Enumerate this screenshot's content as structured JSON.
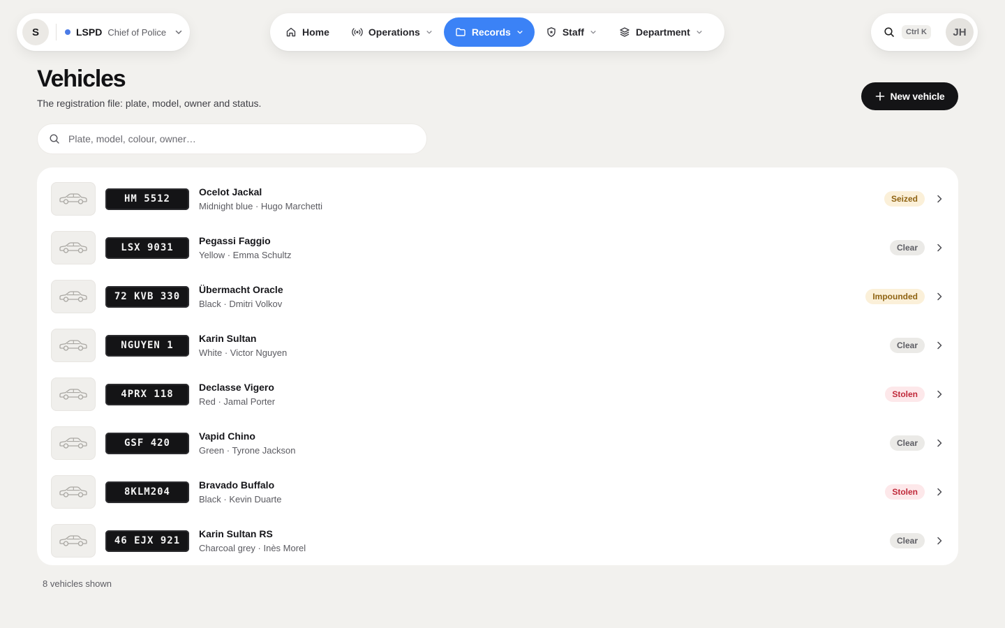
{
  "org": {
    "avatar_letter": "S",
    "name": "LSPD",
    "role": "Chief of Police",
    "status_color": "#4b7be6"
  },
  "nav": {
    "items": [
      {
        "label": "Home",
        "icon": "home-icon"
      },
      {
        "label": "Operations",
        "icon": "broadcast-icon"
      },
      {
        "label": "Records",
        "icon": "folder-icon"
      },
      {
        "label": "Staff",
        "icon": "shield-icon"
      },
      {
        "label": "Department",
        "icon": "layers-icon"
      }
    ],
    "active_color": "#3b82f6"
  },
  "util": {
    "shortcut": "Ctrl K",
    "user_initials": "JH"
  },
  "header": {
    "title": "Vehicles",
    "subtitle": "The registration file: plate, model, owner and status.",
    "new_button_label": "New vehicle"
  },
  "search": {
    "placeholder": "Plate, model, colour, owner…",
    "value": ""
  },
  "vehicles": [
    {
      "plate": "HM 5512",
      "model": "Ocelot Jackal",
      "meta": "Midnight blue · Hugo Marchetti",
      "status": "Seized"
    },
    {
      "plate": "LSX 9031",
      "model": "Pegassi Faggio",
      "meta": "Yellow · Emma Schultz",
      "status": "Clear"
    },
    {
      "plate": "72 KVB 330",
      "model": "Übermacht Oracle",
      "meta": "Black · Dmitri Volkov",
      "status": "Impounded"
    },
    {
      "plate": "NGUYEN 1",
      "model": "Karin Sultan",
      "meta": "White · Victor Nguyen",
      "status": "Clear"
    },
    {
      "plate": "4PRX 118",
      "model": "Declasse Vigero",
      "meta": "Red · Jamal Porter",
      "status": "Stolen"
    },
    {
      "plate": "GSF 420",
      "model": "Vapid Chino",
      "meta": "Green · Tyrone Jackson",
      "status": "Clear"
    },
    {
      "plate": "8KLM204",
      "model": "Bravado Buffalo",
      "meta": "Black · Kevin Duarte",
      "status": "Stolen"
    },
    {
      "plate": "46 EJX 921",
      "model": "Karin Sultan RS",
      "meta": "Charcoal grey · Inès Morel",
      "status": "Clear"
    }
  ],
  "footer": {
    "count_text": "8 vehicles shown"
  }
}
